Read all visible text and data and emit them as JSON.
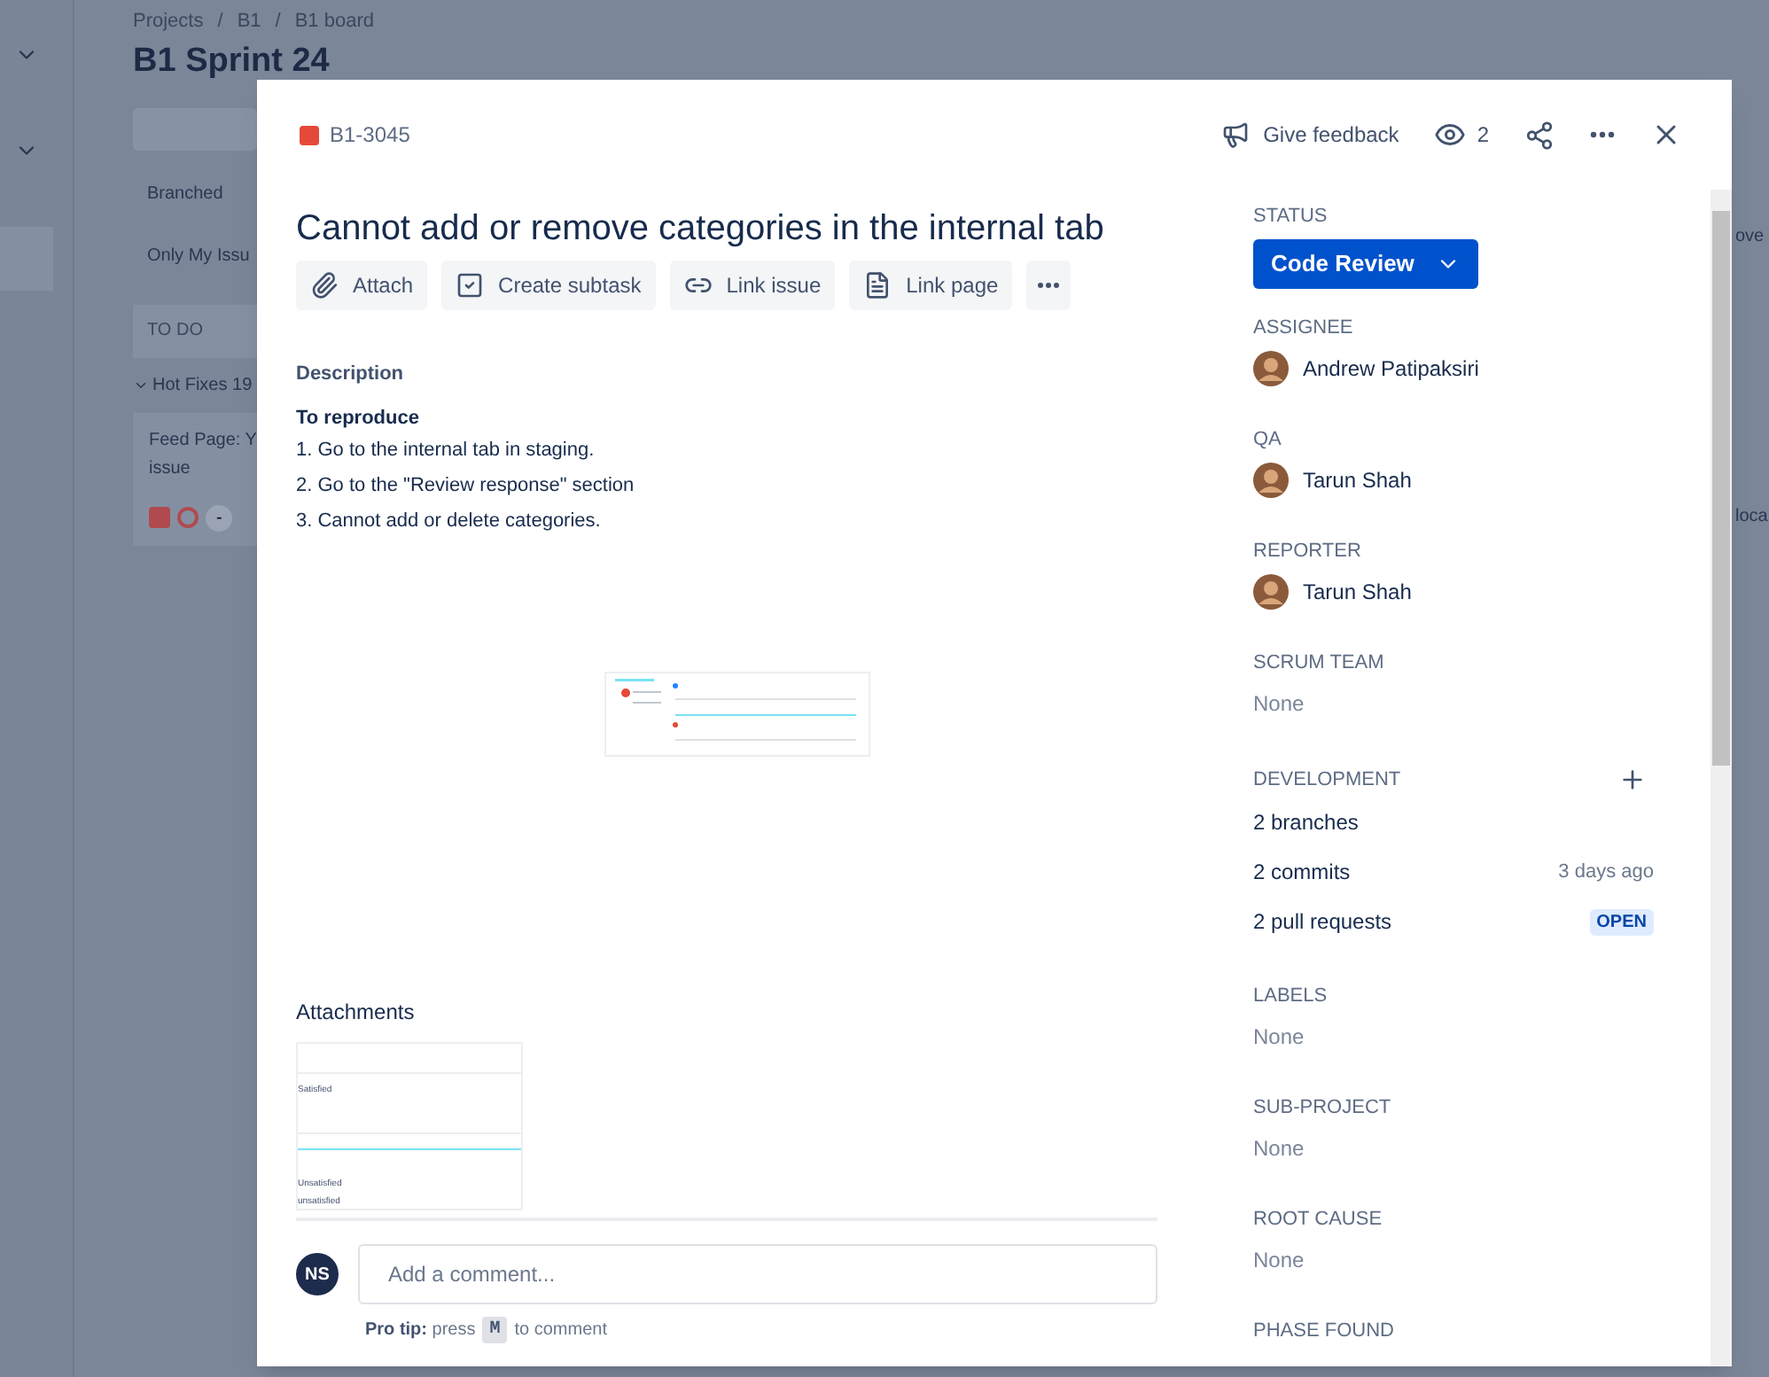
{
  "board": {
    "breadcrumbs": [
      "Projects",
      "B1",
      "B1 board"
    ],
    "title": "B1 Sprint 24",
    "filters": [
      "Branched",
      "Only My Issu"
    ],
    "column": "TO DO",
    "swimlane": "Hot Fixes 19",
    "card_lines": [
      "Feed Page: Y",
      "issue"
    ],
    "card_badge": "-",
    "right_texts": [
      "ove",
      "loca"
    ],
    "separator": "/"
  },
  "issue": {
    "key": "B1-3045",
    "feedback": "Give feedback",
    "watchers": "2",
    "summary": "Cannot add or remove categories in the internal tab",
    "toolbar": [
      {
        "kind": "attach",
        "label": "Attach"
      },
      {
        "kind": "subtask",
        "label": "Create subtask"
      },
      {
        "kind": "link",
        "label": "Link issue"
      },
      {
        "kind": "page",
        "label": "Link page"
      },
      {
        "kind": "more"
      }
    ],
    "description": {
      "heading": "Description",
      "subheading": "To reproduce",
      "steps": [
        "1. Go to the internal tab in staging.",
        "2. Go to the \"Review response\" section",
        "3. Cannot add or delete categories."
      ]
    },
    "attachments": {
      "heading": "Attachments",
      "texts": [
        "Satisfied",
        "Unsatisfied",
        "unsatisfied"
      ]
    },
    "comment": {
      "avatar": "NS",
      "placeholder": "Add a comment...",
      "tip": "**Pro tip:** press",
      "key": "M",
      "tip_end": "to comment"
    }
  },
  "fields": [
    {
      "kind": "status",
      "label": "STATUS",
      "value": "Code Review"
    },
    {
      "kind": "person",
      "label": "ASSIGNEE",
      "value": "Andrew Patipaksiri"
    },
    {
      "kind": "person",
      "label": "QA",
      "value": "Tarun Shah"
    },
    {
      "kind": "person",
      "label": "REPORTER",
      "value": "Tarun Shah"
    },
    {
      "kind": "empty",
      "label": "SCRUM TEAM",
      "value": "None"
    },
    {
      "kind": "development",
      "label": "DEVELOPMENT",
      "items": [
        {
          "text": "2 branches"
        },
        {
          "text": "2 commits",
          "meta": "3 days ago"
        },
        {
          "text": "2 pull requests",
          "badge": "OPEN"
        }
      ]
    },
    {
      "kind": "empty",
      "label": "LABELS",
      "value": "None"
    },
    {
      "kind": "empty",
      "label": "SUB-PROJECT",
      "value": "None"
    },
    {
      "kind": "empty",
      "label": "ROOT CAUSE",
      "value": "None"
    },
    {
      "kind": "heading",
      "label": "PHASE FOUND"
    }
  ]
}
